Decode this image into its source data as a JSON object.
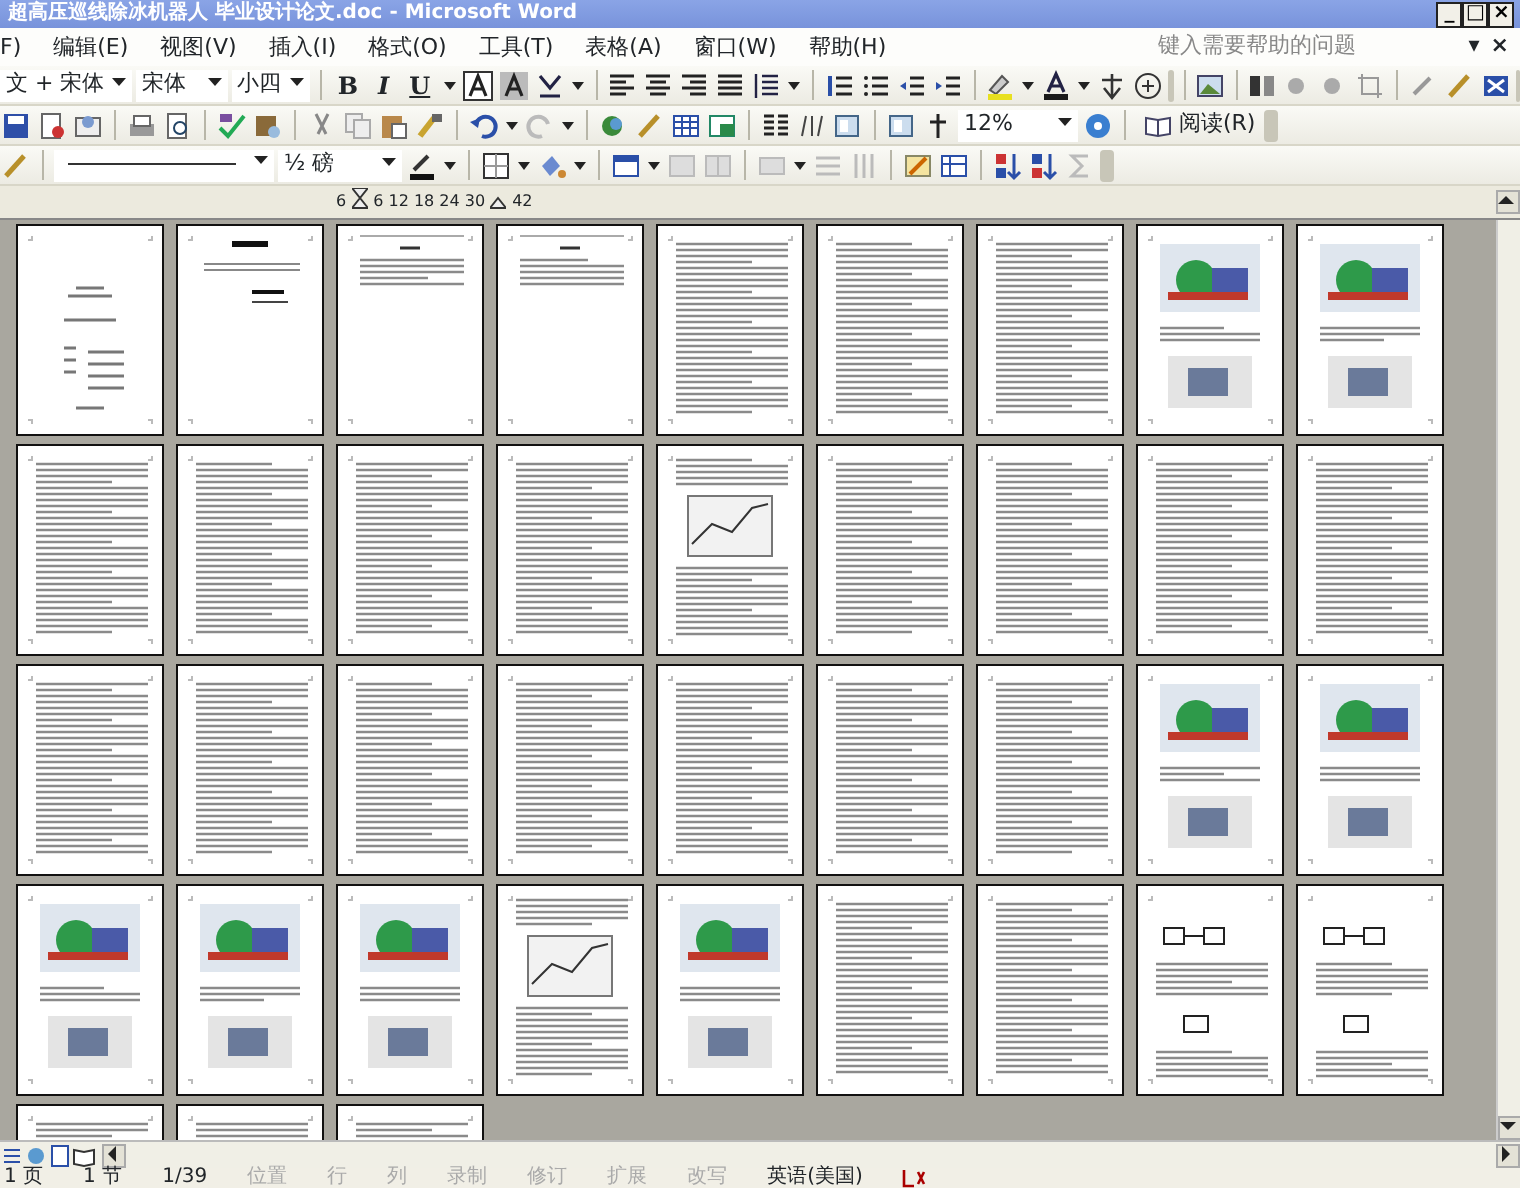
{
  "window": {
    "title": "超高压巡线除冰机器人 毕业设计论文.doc - Microsoft Word",
    "controls": [
      "_",
      "□",
      "×"
    ]
  },
  "menu": {
    "items": [
      "F)",
      "编辑(E)",
      "视图(V)",
      "插入(I)",
      "格式(O)",
      "工具(T)",
      "表格(A)",
      "窗口(W)",
      "帮助(H)"
    ],
    "help_placeholder": "键入需要帮助的问题",
    "help_arrow": "▾",
    "close_document": "×"
  },
  "formatting_toolbar": {
    "style": "文 + 宋体",
    "font": "宋体",
    "size": "小四",
    "bold": "B",
    "italic": "I",
    "underline": "U"
  },
  "standard_toolbar": {
    "zoom": "12%",
    "read": "阅读(R)"
  },
  "tables_toolbar": {
    "line_weight": "½ 磅"
  },
  "ruler": {
    "labels": [
      "6",
      "6 12 18 24 30",
      "42"
    ]
  },
  "pages": [
    {
      "kind": "cover"
    },
    {
      "kind": "title"
    },
    {
      "kind": "heading"
    },
    {
      "kind": "heading"
    },
    {
      "kind": "text"
    },
    {
      "kind": "text"
    },
    {
      "kind": "text"
    },
    {
      "kind": "figure"
    },
    {
      "kind": "figure"
    },
    {
      "kind": "text"
    },
    {
      "kind": "text"
    },
    {
      "kind": "text"
    },
    {
      "kind": "text"
    },
    {
      "kind": "chart"
    },
    {
      "kind": "text"
    },
    {
      "kind": "text"
    },
    {
      "kind": "text"
    },
    {
      "kind": "text"
    },
    {
      "kind": "text"
    },
    {
      "kind": "text"
    },
    {
      "kind": "text"
    },
    {
      "kind": "text"
    },
    {
      "kind": "text"
    },
    {
      "kind": "text"
    },
    {
      "kind": "text"
    },
    {
      "kind": "figure"
    },
    {
      "kind": "figure"
    },
    {
      "kind": "figure"
    },
    {
      "kind": "figure"
    },
    {
      "kind": "figure"
    },
    {
      "kind": "chart"
    },
    {
      "kind": "figure"
    },
    {
      "kind": "text"
    },
    {
      "kind": "text"
    },
    {
      "kind": "diagram"
    },
    {
      "kind": "diagram"
    },
    {
      "kind": "text"
    },
    {
      "kind": "text"
    },
    {
      "kind": "text"
    }
  ],
  "status_bar": [
    {
      "text": "1 页",
      "disabled": false
    },
    {
      "text": "1 节",
      "disabled": false
    },
    {
      "text": "1/39",
      "disabled": false
    },
    {
      "text": "位置",
      "disabled": true
    },
    {
      "text": "行",
      "disabled": true
    },
    {
      "text": "列",
      "disabled": true
    },
    {
      "text": "录制",
      "disabled": true
    },
    {
      "text": "修订",
      "disabled": true
    },
    {
      "text": "扩展",
      "disabled": true
    },
    {
      "text": "改写",
      "disabled": true
    },
    {
      "text": "英语(美国)",
      "disabled": false
    }
  ]
}
